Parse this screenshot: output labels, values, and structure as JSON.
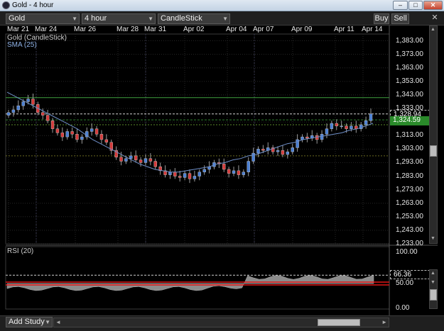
{
  "window": {
    "title": "Gold - 4 hour",
    "min_label": "–",
    "max_label": "□",
    "close_label": "✕"
  },
  "toolbar": {
    "symbol": "Gold",
    "period": "4 hour",
    "chart_type": "CandleStick",
    "buy_label": "Buy",
    "sell_label": "Sell",
    "close_label": "✕",
    "dropdown_arrow": "▼"
  },
  "dates": [
    "Mar 21",
    "Mar 24",
    "Mar 26",
    "Mar 28",
    "Mar 31",
    "Apr 02",
    "Apr 04",
    "Apr 07",
    "Apr 09",
    "Apr 11",
    "Apr 14"
  ],
  "legend": {
    "series": "Gold (CandleStick)",
    "indicator": "SMA (25)",
    "rsi": "RSI (20)"
  },
  "price_axis": [
    "1,383.00",
    "1,373.00",
    "1,363.00",
    "1,353.00",
    "1,343.00",
    "1,333.00",
    "1,313.00",
    "1,303.00",
    "1,293.00",
    "1,283.00",
    "1,273.00",
    "1,263.00",
    "1,253.00",
    "1,243.00",
    "1,233.00"
  ],
  "price_tags": {
    "last": "1,328.94",
    "sma": "1,324.59"
  },
  "rsi_axis": [
    "100.00",
    "50.00",
    "0.00"
  ],
  "rsi_tag": "66.36",
  "bottom": {
    "add_study": "Add Study",
    "arrow_left": "◄",
    "arrow_right": "►"
  },
  "colors": {
    "bull": "#4a7fd4",
    "bear": "#d63b3b",
    "sma": "#6f8fc8",
    "hline_green": "#3fa03f",
    "last_price": "#d0d0d0",
    "sma_tag": "#2a8a2a",
    "rsi_fill": "#8c8c8c",
    "rsi_line": "#e01515"
  },
  "chart_data": {
    "type": "candlestick",
    "title": "Gold (CandleStick)",
    "timeframe": "4 hour",
    "x": [
      "Mar 21",
      "Mar 24",
      "Mar 26",
      "Mar 28",
      "Mar 31",
      "Apr 02",
      "Apr 04",
      "Apr 07",
      "Apr 09",
      "Apr 11",
      "Apr 14"
    ],
    "ylim": [
      1233,
      1388
    ],
    "ohlc_close": [
      1330,
      1332,
      1335,
      1338,
      1340,
      1336,
      1330,
      1328,
      1324,
      1318,
      1315,
      1312,
      1316,
      1314,
      1310,
      1312,
      1316,
      1318,
      1314,
      1310,
      1308,
      1302,
      1297,
      1294,
      1296,
      1298,
      1295,
      1293,
      1296,
      1294,
      1290,
      1287,
      1284,
      1286,
      1283,
      1282,
      1285,
      1281,
      1283,
      1286,
      1288,
      1290,
      1293,
      1292,
      1288,
      1285,
      1287,
      1284,
      1286,
      1294,
      1300,
      1303,
      1302,
      1304,
      1301,
      1302,
      1299,
      1301,
      1304,
      1310,
      1312,
      1311,
      1313,
      1310,
      1314,
      1318,
      1322,
      1320,
      1320,
      1318,
      1320,
      1318,
      1321,
      1324,
      1329
    ],
    "sma_25": [
      1345,
      1342,
      1339,
      1336,
      1333,
      1330,
      1327,
      1324,
      1321,
      1318,
      1314,
      1310,
      1307,
      1304,
      1301,
      1298,
      1295,
      1292,
      1290,
      1288,
      1287,
      1286,
      1286,
      1287,
      1288,
      1289,
      1290,
      1292,
      1293,
      1295,
      1296,
      1298,
      1299,
      1301,
      1303,
      1305,
      1307,
      1308,
      1310,
      1311,
      1312,
      1313,
      1314,
      1315,
      1317,
      1318,
      1320,
      1322
    ],
    "horizontal_lines": [
      1341,
      1328.94,
      1324.59,
      1321,
      1298
    ],
    "last_price": 1328.94,
    "sma_value": 1324.59,
    "rsi": {
      "name": "RSI (20)",
      "ylim": [
        0,
        100
      ],
      "last": 66.36,
      "levels": [
        50
      ]
    }
  }
}
